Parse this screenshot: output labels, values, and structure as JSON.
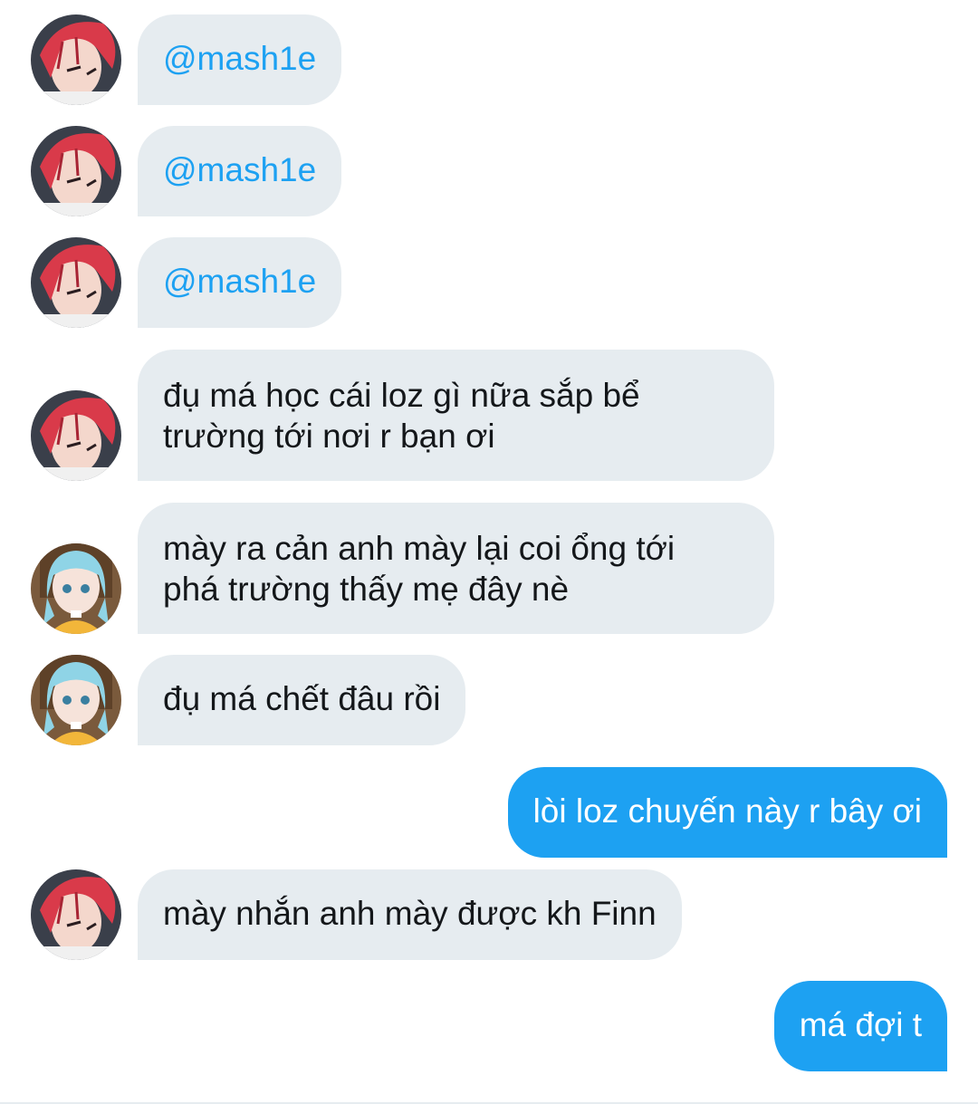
{
  "colors": {
    "incoming_bubble": "#e6ecf0",
    "outgoing_bubble": "#1da1f2",
    "mention": "#1da1f2",
    "text": "#14171a"
  },
  "messages": [
    {
      "sender": "red-hair-avatar",
      "text": "@mash1e"
    },
    {
      "sender": "red-hair-avatar",
      "text": "@mash1e"
    },
    {
      "sender": "red-hair-avatar",
      "text": "@mash1e"
    },
    {
      "sender": "red-hair-avatar",
      "text": "đụ má học cái loz gì nữa sắp bể\ntrường tới nơi r bạn ơi"
    },
    {
      "sender": "blue-hair-avatar",
      "text": "mày ra cản anh mày lại coi ổng tới\nphá trường thấy mẹ đây nè"
    },
    {
      "sender": "blue-hair-avatar",
      "text": "đụ má chết đâu rồi"
    },
    {
      "sender": "self",
      "text": "lòi loz chuyến này r bây ơi"
    },
    {
      "sender": "red-hair-avatar",
      "text": "mày nhắn anh mày được kh Finn"
    },
    {
      "sender": "self",
      "text": "má đợi t"
    }
  ]
}
